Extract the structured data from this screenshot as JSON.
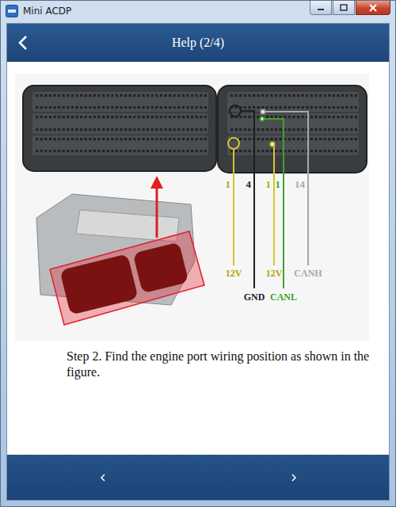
{
  "window": {
    "title": "Mini ACDP"
  },
  "header": {
    "title": "Help (2/4)"
  },
  "figure": {
    "wires": [
      {
        "pin": "1",
        "label": "12V",
        "color": "#d6c52e"
      },
      {
        "pin": "4",
        "label": "GND",
        "color": "#1e1e1e"
      },
      {
        "pin": "1",
        "label": "12V",
        "color": "#d6c52e"
      },
      {
        "pin": "1",
        "label": "CANL",
        "color": "#3fa32c"
      },
      {
        "pin": "14",
        "label": "CANH",
        "color": "#a8a8a8"
      }
    ]
  },
  "caption": "Step 2. Find the engine port wiring position as shown in the figure."
}
